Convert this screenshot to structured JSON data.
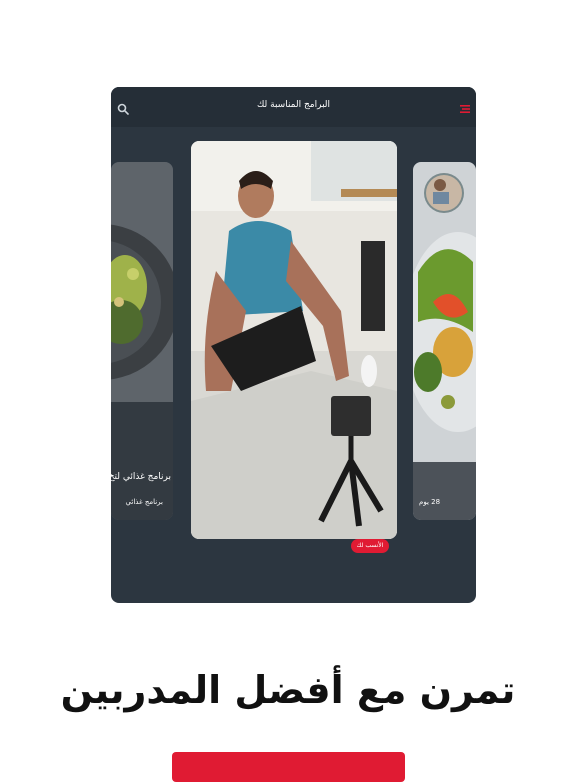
{
  "app": {
    "header_title": "البرامج المناسبة لك"
  },
  "cards": {
    "left": {
      "title": "برنامج غذائي لتخ",
      "subtitle": "برنامج غذائي"
    },
    "center": {
      "badge": "الأنسب لك"
    },
    "right": {
      "duration": "28 يوم"
    }
  },
  "headline": "تمرن مع أفضل المدربين",
  "colors": {
    "accent": "#e01b33",
    "panel": "#2c3640",
    "topbar": "#252e37"
  },
  "icons": {
    "search": "search-icon",
    "menu": "menu-icon"
  }
}
